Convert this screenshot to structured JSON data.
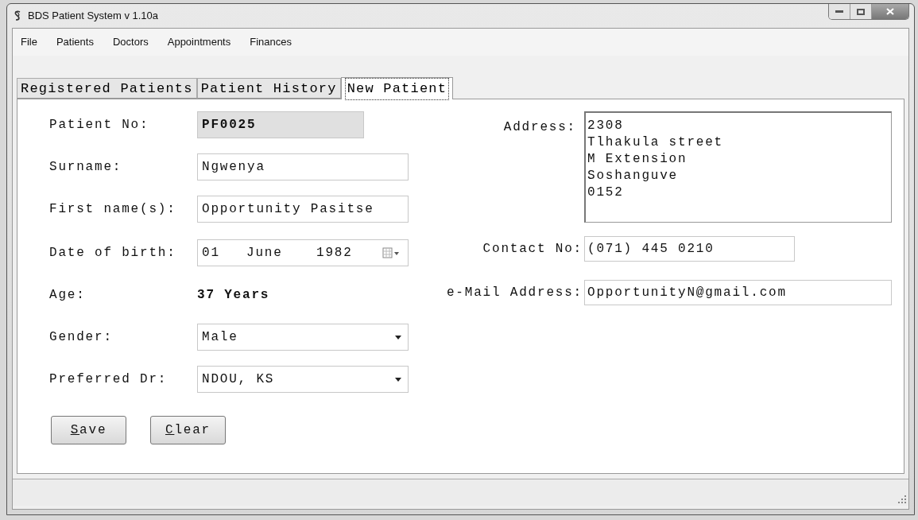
{
  "window": {
    "title": "BDS Patient System v 1.10a"
  },
  "menu": [
    "File",
    "Patients",
    "Doctors",
    "Appointments",
    "Finances"
  ],
  "tabs": [
    {
      "label": "Registered Patients",
      "selected": false
    },
    {
      "label": "Patient History",
      "selected": false
    },
    {
      "label": "New Patient",
      "selected": true
    }
  ],
  "form": {
    "left": [
      {
        "kind": "readonly",
        "label": "Patient No:",
        "value": "PF0025"
      },
      {
        "kind": "text",
        "label": "Surname:",
        "value": "Ngwenya"
      },
      {
        "kind": "text",
        "label": "First name(s):",
        "value": "Opportunity Pasitse"
      },
      {
        "kind": "date",
        "label": "Date of birth:",
        "day": "01",
        "month": "June",
        "year": "1982"
      },
      {
        "kind": "static",
        "label": "Age:",
        "value": "37 Years"
      },
      {
        "kind": "dropdown",
        "label": "Gender:",
        "value": "Male"
      },
      {
        "kind": "dropdown",
        "label": "Preferred Dr:",
        "value": "NDOU, KS"
      }
    ],
    "address": {
      "label": "Address:",
      "lines": [
        "2308",
        "Tlhakula street",
        "M Extension",
        "Soshanguve",
        "0152"
      ]
    },
    "contact": {
      "label": "Contact No:",
      "value": "(071) 445 0210"
    },
    "email": {
      "label": "e-Mail Address:",
      "value": "OpportunityN@gmail.com"
    }
  },
  "buttons": [
    {
      "access_key": "S",
      "label_rest": "ave"
    },
    {
      "access_key": "C",
      "label_rest": "lear"
    }
  ]
}
